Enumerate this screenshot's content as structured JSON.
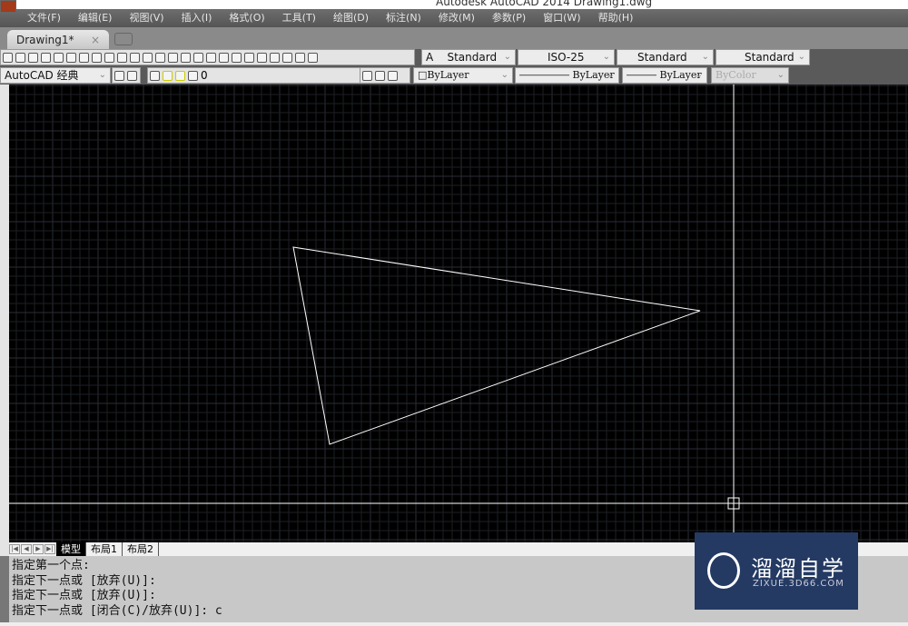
{
  "window": {
    "title": "Autodesk AutoCAD 2014    Drawing1.dwg"
  },
  "menu": [
    "文件(F)",
    "编辑(E)",
    "视图(V)",
    "插入(I)",
    "格式(O)",
    "工具(T)",
    "绘图(D)",
    "标注(N)",
    "修改(M)",
    "参数(P)",
    "窗口(W)",
    "帮助(H)"
  ],
  "doc_tab": {
    "label": "Drawing1*",
    "close": "×"
  },
  "styles": {
    "text_style": "Standard",
    "dim_style": "ISO-25",
    "table_style": "Standard",
    "multileader_style": "Standard"
  },
  "workspace": "AutoCAD 经典",
  "layer": "0",
  "properties": {
    "color": "ByLayer",
    "linetype": "ByLayer",
    "lineweight": "ByLayer",
    "plotstyle": "ByColor"
  },
  "layout_tabs": [
    "模型",
    "布局1",
    "布局2"
  ],
  "command_history": [
    "指定第一个点:",
    "指定下一点或 [放弃(U)]:",
    "指定下一点或 [放弃(U)]:",
    "指定下一点或 [闭合(C)/放弃(U)]: c"
  ],
  "watermark": {
    "name": "溜溜自学",
    "url": "ZIXUE.3D66.COM"
  },
  "colors": {
    "canvas": "#000000",
    "line": "#ffffff",
    "grid": "#1c1f24",
    "grid_major": "#2a2e36"
  }
}
